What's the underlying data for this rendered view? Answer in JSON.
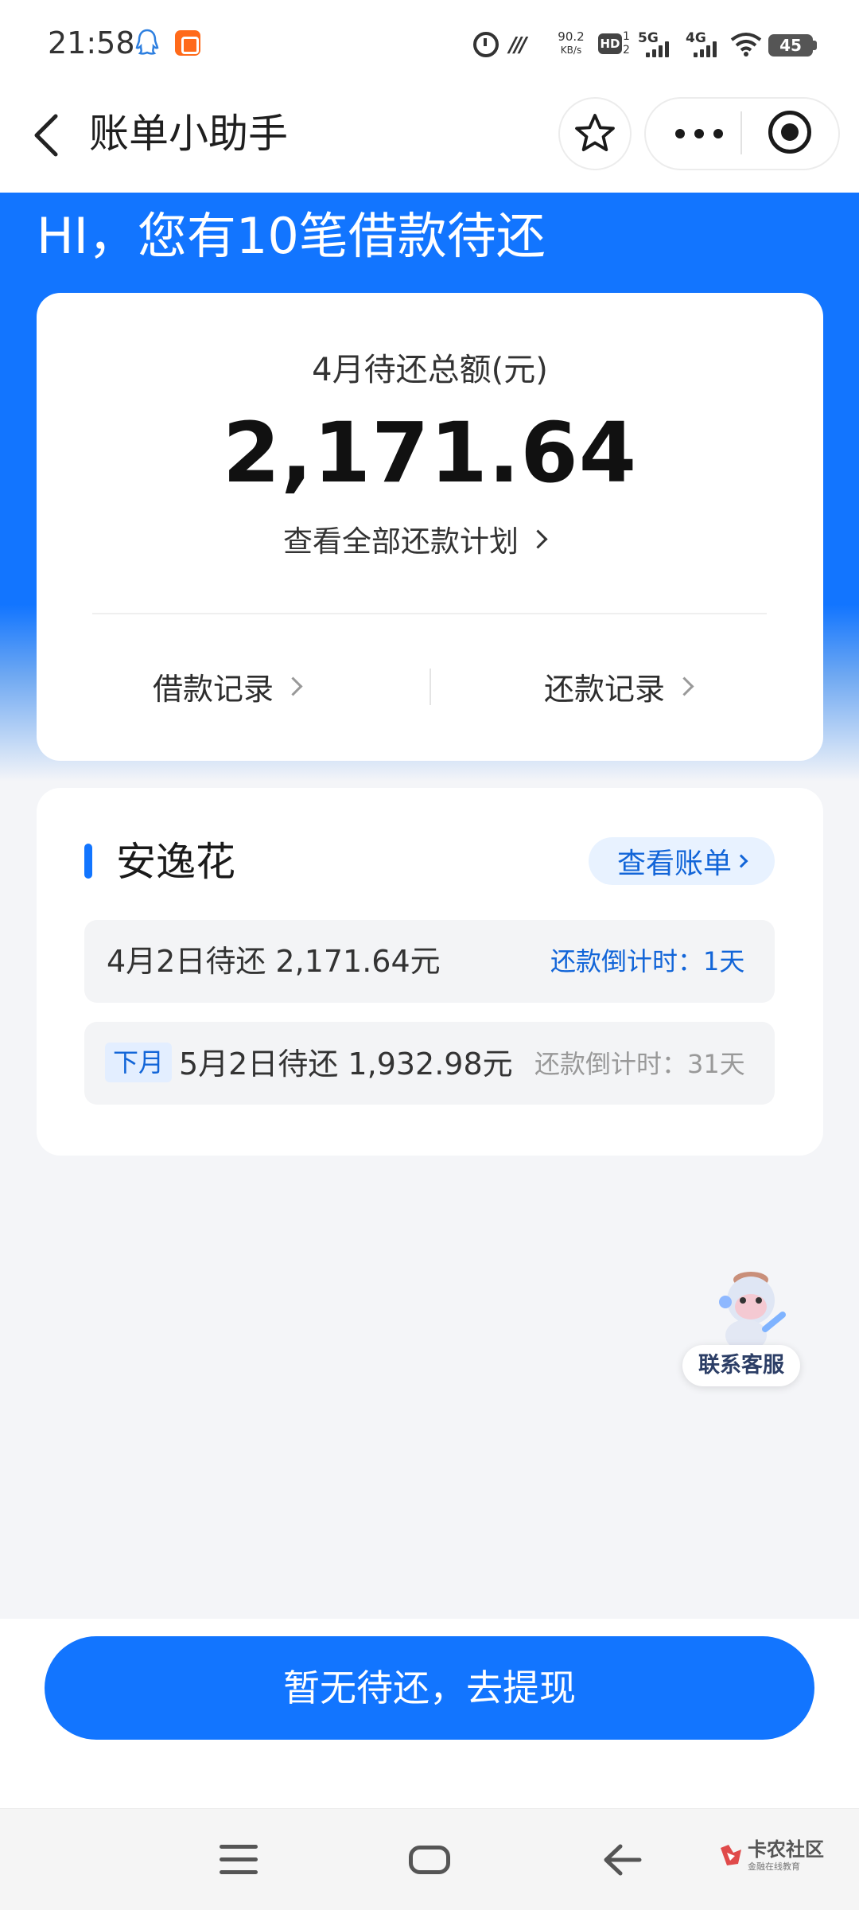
{
  "status_bar": {
    "time": "21:58",
    "net_speed_value": "90.2",
    "net_speed_unit": "KB/s",
    "hd_label": "HD",
    "hd_sub": "1\n2",
    "sig1_label": "5G",
    "sig2_label": "4G",
    "battery": "45"
  },
  "nav": {
    "title": "账单小助手"
  },
  "header": {
    "greeting": "HI，您有10笔借款待还"
  },
  "summary": {
    "label": "4月待还总额(元)",
    "amount": "2,171.64",
    "plan_link": "查看全部还款计划",
    "loan_records": "借款记录",
    "repay_records": "还款记录"
  },
  "bill": {
    "title": "安逸花",
    "view_bill": "查看账单",
    "rows": [
      {
        "tag": "",
        "text": "4月2日待还 2,171.64元",
        "countdown": "还款倒计时：1天"
      },
      {
        "tag": "下月",
        "text": "5月2日待还 1,932.98元",
        "countdown": "还款倒计时：31天"
      }
    ]
  },
  "service": {
    "label": "联系客服"
  },
  "action": {
    "button": "暂无待还，去提现"
  },
  "watermark": {
    "name": "卡农社区",
    "sub": "金融在线教育"
  },
  "colors": {
    "primary": "#1275ff",
    "link_blue": "#1265d8",
    "page_bg": "#f4f5f8"
  }
}
